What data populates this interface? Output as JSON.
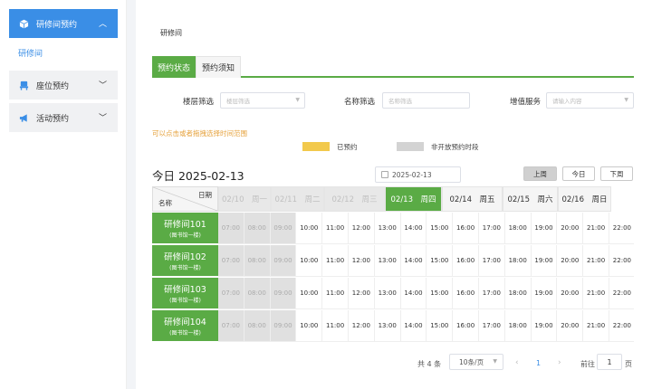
{
  "sidebar": {
    "menus": [
      {
        "label": "研修间预约",
        "icon": "cube-icon",
        "expanded": true
      },
      {
        "label": "座位预约",
        "icon": "seat-icon",
        "expanded": false
      },
      {
        "label": "活动预约",
        "icon": "megaphone-icon",
        "expanded": false
      }
    ],
    "submenu_label": "研修间"
  },
  "breadcrumb": "研修间",
  "tabs": [
    {
      "label": "预约状态",
      "active": true
    },
    {
      "label": "预约须知",
      "active": false
    }
  ],
  "filters": [
    {
      "label": "楼层筛选",
      "placeholder": "楼层筛选"
    },
    {
      "label": "名称筛选",
      "placeholder": "名称筛选"
    },
    {
      "label": "增值服务",
      "placeholder": "请输入内容"
    }
  ],
  "hint": "可以点击或者拖拽选择时间范围",
  "legend": [
    {
      "label": "已预约",
      "color": "#f2c94c"
    },
    {
      "label": "非开放预约时段",
      "color": "#d3d3d3"
    }
  ],
  "today_label": "今日 2025-02-13",
  "date_value": "2025-02-13",
  "week_buttons": {
    "prev": "上周",
    "today": "今日",
    "next": "下周"
  },
  "grid": {
    "corner_top": "日期",
    "corner_bottom": "名称",
    "days": [
      {
        "label": "02/10　周一",
        "state": "past"
      },
      {
        "label": "02/11　周二",
        "state": "past"
      },
      {
        "label": "02/12　周三",
        "state": "past"
      },
      {
        "label": "02/13　周四",
        "state": "today"
      },
      {
        "label": "02/14　周五",
        "state": "future"
      },
      {
        "label": "02/15　周六",
        "state": "future"
      },
      {
        "label": "02/16　周日",
        "state": "future"
      }
    ],
    "times": [
      "07:00",
      "08:00",
      "09:00",
      "10:00",
      "11:00",
      "12:00",
      "13:00",
      "14:00",
      "15:00",
      "16:00",
      "17:00",
      "18:00",
      "19:00",
      "20:00",
      "21:00",
      "22:00"
    ],
    "unavailable_times": [
      "07:00",
      "08:00",
      "09:00"
    ],
    "rooms": [
      {
        "name": "研修间101",
        "location": "(图书馆一楼)"
      },
      {
        "name": "研修间102",
        "location": "(图书馆一楼)"
      },
      {
        "name": "研修间103",
        "location": "(图书馆一楼)"
      },
      {
        "name": "研修间104",
        "location": "(图书馆一楼)"
      }
    ]
  },
  "pagination": {
    "total": "共 4 条",
    "page_size": "10条/页",
    "current_page": "1",
    "goto_label": "前往",
    "goto_value": "1",
    "page_suffix": "页"
  },
  "colors": {
    "accent_green": "#5aab45",
    "accent_blue": "#3a8ee6",
    "hint_orange": "#e6a23c"
  }
}
